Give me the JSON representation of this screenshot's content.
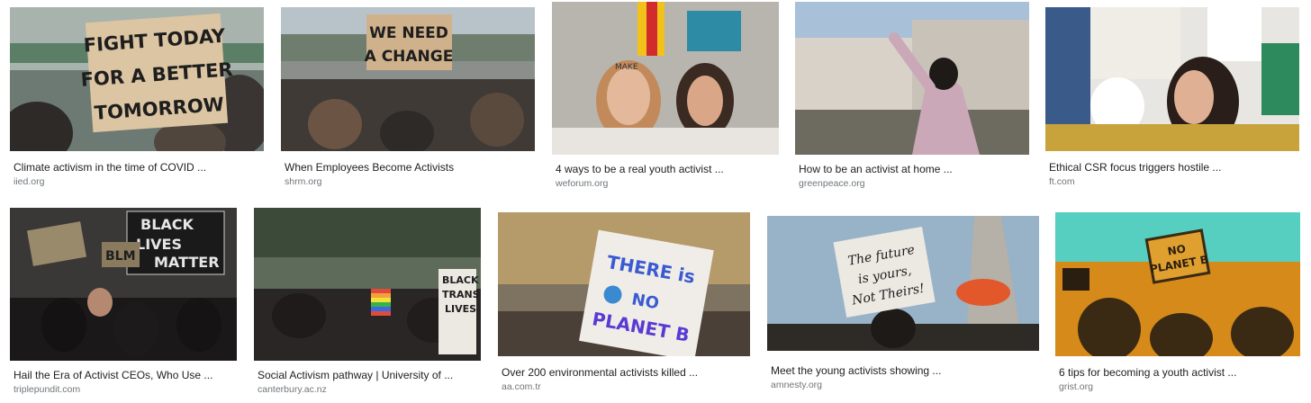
{
  "results": [
    {
      "title": "Climate activism in the time of COVID ...",
      "source": "iied.org",
      "sign_text": [
        "FIGHT TODAY",
        "FOR A BETTER",
        "TOMORROW"
      ]
    },
    {
      "title": "When Employees Become Activists",
      "source": "shrm.org",
      "sign_text": [
        "WE NEED",
        "A CHANGE"
      ]
    },
    {
      "title": "4 ways to be a real youth activist ...",
      "source": "weforum.org",
      "sign_text": [
        "MAKE"
      ]
    },
    {
      "title": "How to be an activist at home ...",
      "source": "greenpeace.org",
      "sign_text": []
    },
    {
      "title": "Ethical CSR focus triggers hostile ...",
      "source": "ft.com",
      "sign_text": []
    },
    {
      "title": "Hail the Era of Activist CEOs, Who Use ...",
      "source": "triplepundit.com",
      "sign_text": [
        "BLACK",
        "LIVES",
        "MATTER",
        "BLM"
      ]
    },
    {
      "title": "Social Activism pathway | University of ...",
      "source": "canterbury.ac.nz",
      "sign_text": [
        "BLACK",
        "TRANS",
        "LIVES"
      ]
    },
    {
      "title": "Over 200 environmental activists killed ...",
      "source": "aa.com.tr",
      "sign_text": [
        "THERE is",
        "NO",
        "PLANET B"
      ]
    },
    {
      "title": "Meet the young activists showing ...",
      "source": "amnesty.org",
      "sign_text": [
        "The future",
        "is yours,",
        "Not Theirs!"
      ]
    },
    {
      "title": "6 tips for becoming a youth activist ...",
      "source": "grist.org",
      "sign_text": [
        "NO",
        "PLANET B"
      ]
    }
  ]
}
